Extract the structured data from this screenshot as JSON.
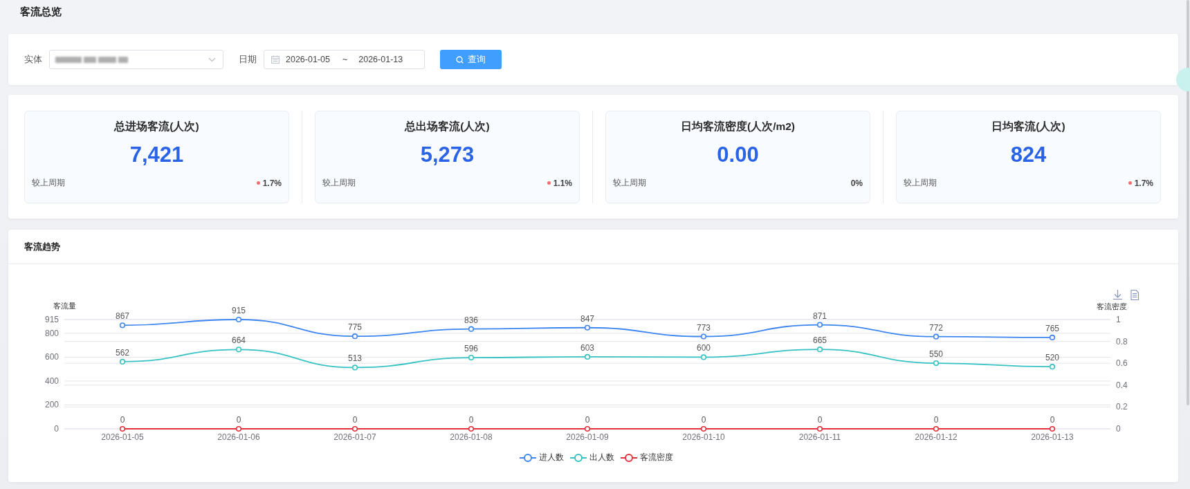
{
  "page": {
    "title": "客流总览"
  },
  "filters": {
    "entity": {
      "label": "实体",
      "value_blurred": true
    },
    "date": {
      "label": "日期",
      "start": "2026-01-05",
      "separator": "~",
      "end": "2026-01-13"
    },
    "search_button": {
      "label": "查询"
    }
  },
  "stats": [
    {
      "title": "总进场客流(人次)",
      "value": "7,421",
      "compare_label": "较上周期",
      "change": "1.7%",
      "increased": true
    },
    {
      "title": "总出场客流(人次)",
      "value": "5,273",
      "compare_label": "较上周期",
      "change": "1.1%",
      "increased": true
    },
    {
      "title": "日均客流密度(人次/m2)",
      "value": "0.00",
      "compare_label": "较上周期",
      "change": "0%",
      "increased": false
    },
    {
      "title": "日均客流(人次)",
      "value": "824",
      "compare_label": "较上周期",
      "change": "1.7%",
      "increased": true
    }
  ],
  "trend_panel": {
    "title": "客流趋势",
    "chart": {
      "right_axis": {
        "label": "客流密度",
        "ticks": [
          "1",
          "0.8",
          "0.6",
          "0.4",
          "0.2",
          "0"
        ]
      },
      "chart_data": {
        "type": "line",
        "ylabel": "客流量",
        "categories": [
          "2026-01-05",
          "2026-01-06",
          "2026-01-07",
          "2026-01-08",
          "2026-01-09",
          "2026-01-10",
          "2026-01-11",
          "2026-01-12",
          "2026-01-13"
        ],
        "series": [
          {
            "name": "进人数",
            "color": "#3d85f0",
            "marker": "circle",
            "values": [
              867,
              915,
              775,
              836,
              847,
              773,
              871,
              772,
              765
            ]
          },
          {
            "name": "出人数",
            "color": "#36c2c2",
            "marker": "circle",
            "values": [
              562,
              664,
              513,
              596,
              603,
              600,
              665,
              550,
              520
            ]
          },
          {
            "name": "客流密度",
            "color": "#e3323d",
            "marker": "circle",
            "values": [
              0,
              0,
              0,
              0,
              0,
              0,
              0,
              0,
              0
            ]
          }
        ],
        "ylim": [
          0,
          915
        ],
        "yticks": [
          0,
          200,
          400,
          600,
          800,
          915
        ],
        "grid": true,
        "legend": "bottom",
        "data_labels": true
      }
    }
  }
}
